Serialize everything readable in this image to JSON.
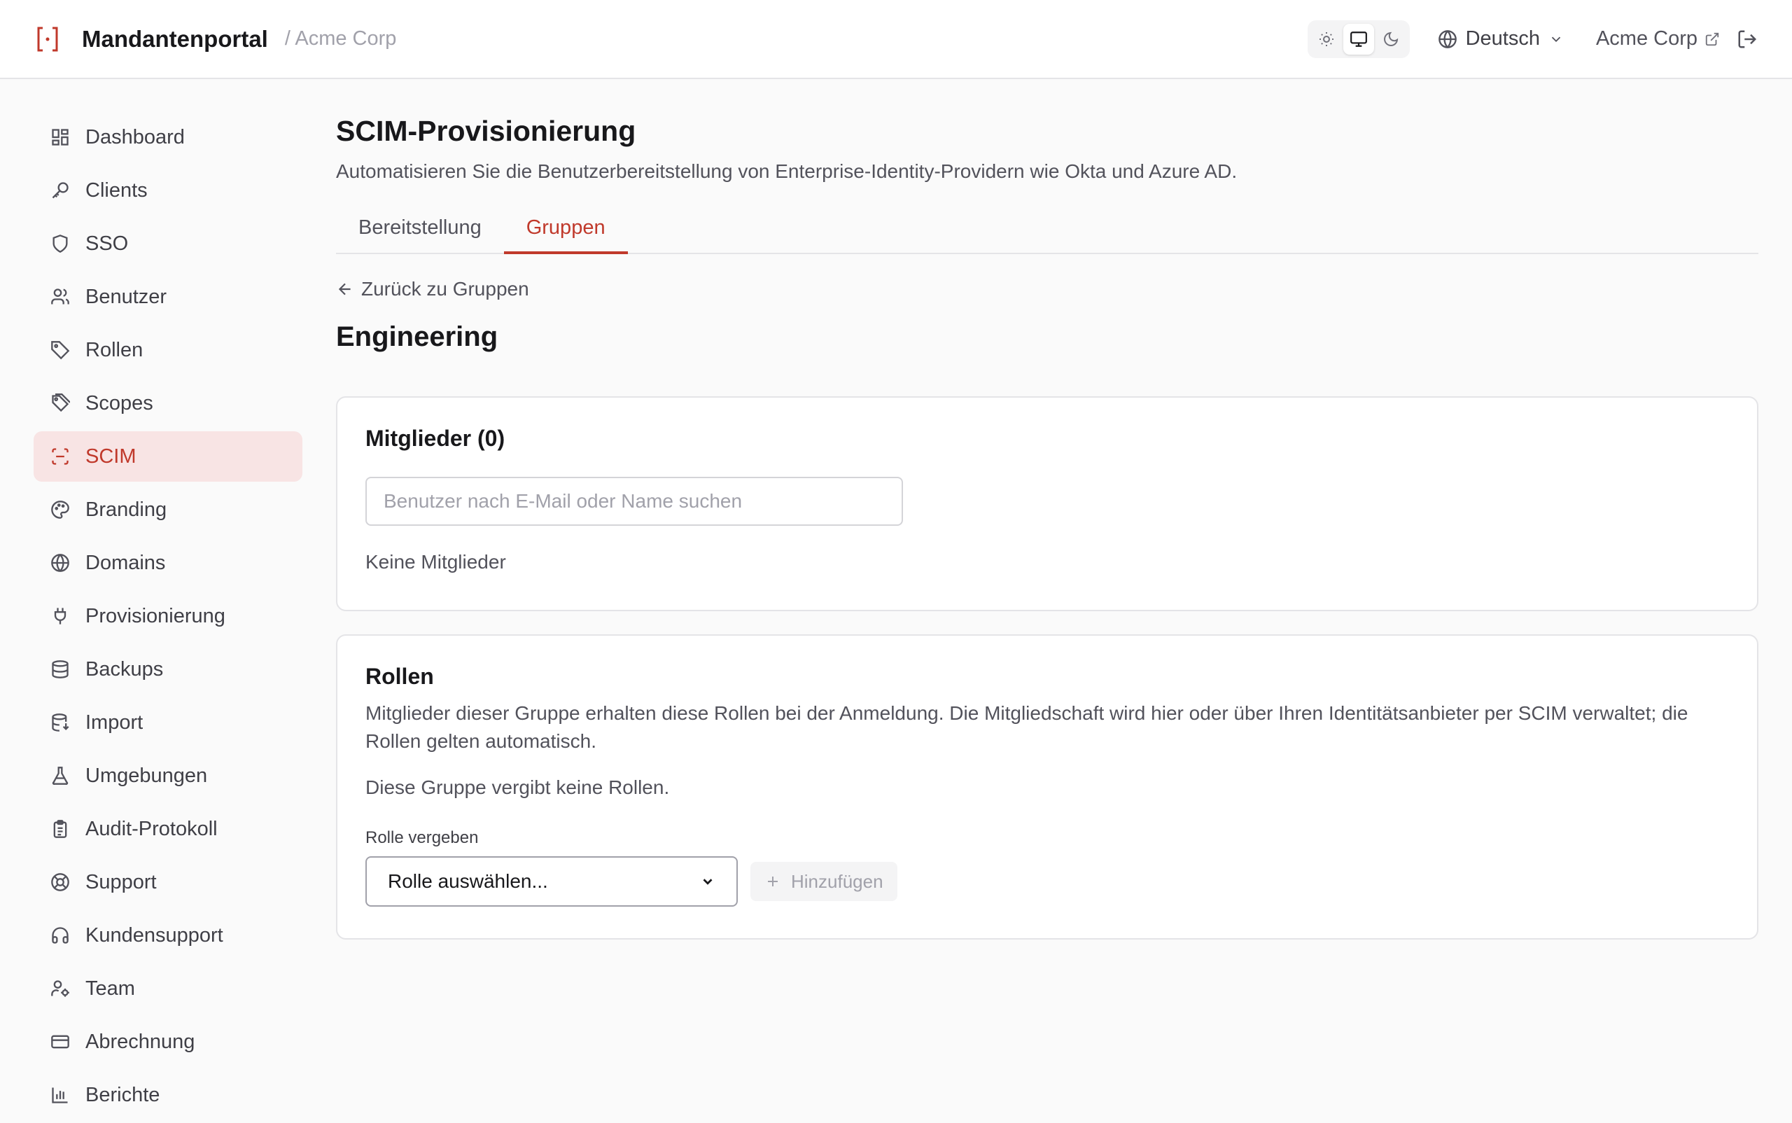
{
  "header": {
    "brand": "Mandantenportal",
    "tenant": "/ Acme Corp",
    "language": "Deutsch",
    "org_link": "Acme Corp",
    "theme_active": "system"
  },
  "sidebar": {
    "items": [
      {
        "label": "Dashboard",
        "icon": "dashboard-icon"
      },
      {
        "label": "Clients",
        "icon": "key-icon"
      },
      {
        "label": "SSO",
        "icon": "shield-icon"
      },
      {
        "label": "Benutzer",
        "icon": "users-icon"
      },
      {
        "label": "Rollen",
        "icon": "tag-icon"
      },
      {
        "label": "Scopes",
        "icon": "tags-icon"
      },
      {
        "label": "SCIM",
        "icon": "scan-icon",
        "active": true
      },
      {
        "label": "Branding",
        "icon": "palette-icon"
      },
      {
        "label": "Domains",
        "icon": "globe-icon"
      },
      {
        "label": "Provisionierung",
        "icon": "plug-icon"
      },
      {
        "label": "Backups",
        "icon": "database-icon"
      },
      {
        "label": "Import",
        "icon": "database-import-icon"
      },
      {
        "label": "Umgebungen",
        "icon": "flask-icon"
      },
      {
        "label": "Audit-Protokoll",
        "icon": "clipboard-icon"
      },
      {
        "label": "Support",
        "icon": "lifebuoy-icon"
      },
      {
        "label": "Kundensupport",
        "icon": "headphones-icon"
      },
      {
        "label": "Team",
        "icon": "user-cog-icon"
      },
      {
        "label": "Abrechnung",
        "icon": "credit-card-icon"
      },
      {
        "label": "Berichte",
        "icon": "bar-chart-icon"
      }
    ]
  },
  "main": {
    "title": "SCIM-Provisionierung",
    "subtitle": "Automatisieren Sie die Benutzerbereitstellung von Enterprise-Identity-Providern wie Okta und Azure AD.",
    "tabs": [
      {
        "label": "Bereitstellung",
        "active": false
      },
      {
        "label": "Gruppen",
        "active": true
      }
    ],
    "back_label": "Zurück zu Gruppen",
    "group_name": "Engineering",
    "members": {
      "title": "Mitglieder (0)",
      "search_placeholder": "Benutzer nach E-Mail oder Name suchen",
      "empty": "Keine Mitglieder"
    },
    "roles": {
      "title": "Rollen",
      "description": "Mitglieder dieser Gruppe erhalten diese Rollen bei der Anmeldung. Die Mitgliedschaft wird hier oder über Ihren Identitätsanbieter per SCIM verwaltet; die Rollen gelten automatisch.",
      "empty": "Diese Gruppe vergibt keine Rollen.",
      "assign_label": "Rolle vergeben",
      "select_value": "Rolle auswählen...",
      "add_label": "Hinzufügen"
    }
  },
  "colors": {
    "accent": "#c0392b",
    "active_bg": "#f8e4e4"
  }
}
